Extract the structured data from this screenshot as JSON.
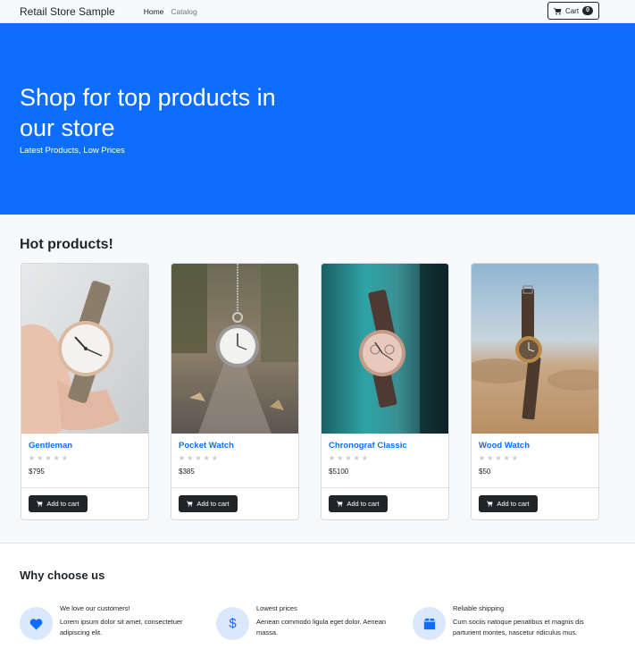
{
  "navbar": {
    "brand": "Retail Store Sample",
    "links": [
      {
        "label": "Home",
        "active": true
      },
      {
        "label": "Catalog",
        "active": false
      }
    ],
    "cart_label": "Cart",
    "cart_count": "0",
    "cart_icon": "cart-icon"
  },
  "hero": {
    "title": "Shop for top products in our store",
    "subtitle": "Latest Products, Low Prices",
    "background": "#0d6efd"
  },
  "hot_products": {
    "title": "Hot products!",
    "products": [
      {
        "name": "Gentleman",
        "price": "$795",
        "rating": 0,
        "image": "wrist-watch-in-hand-photo",
        "add_label": "Add to cart"
      },
      {
        "name": "Pocket Watch",
        "price": "$385",
        "rating": 0,
        "image": "hanging-pocket-watch-photo",
        "add_label": "Add to cart"
      },
      {
        "name": "Chronograf Classic",
        "price": "$5100",
        "rating": 0,
        "image": "chronograph-watch-on-teal-wall-photo",
        "add_label": "Add to cart"
      },
      {
        "name": "Wood Watch",
        "price": "$50",
        "rating": 0,
        "image": "wood-watch-desert-photo",
        "add_label": "Add to cart"
      }
    ]
  },
  "why": {
    "title": "Why choose us",
    "features": [
      {
        "icon": "heart-icon",
        "title": "We love our customers!",
        "text": "Lorem ipsum dolor sit amet, consectetuer adipiscing elit."
      },
      {
        "icon": "dollar-icon",
        "title": "Lowest prices",
        "text": "Aenean commodo ligula eget dolor. Aenean massa."
      },
      {
        "icon": "box-icon",
        "title": "Reliable shipping",
        "text": "Cum sociis natoque penatibus et magnis dis parturient montes, nascetur ridiculus mus."
      }
    ]
  },
  "colors": {
    "primary": "#0d6efd",
    "dark": "#212529",
    "light": "#f8f9fa"
  }
}
